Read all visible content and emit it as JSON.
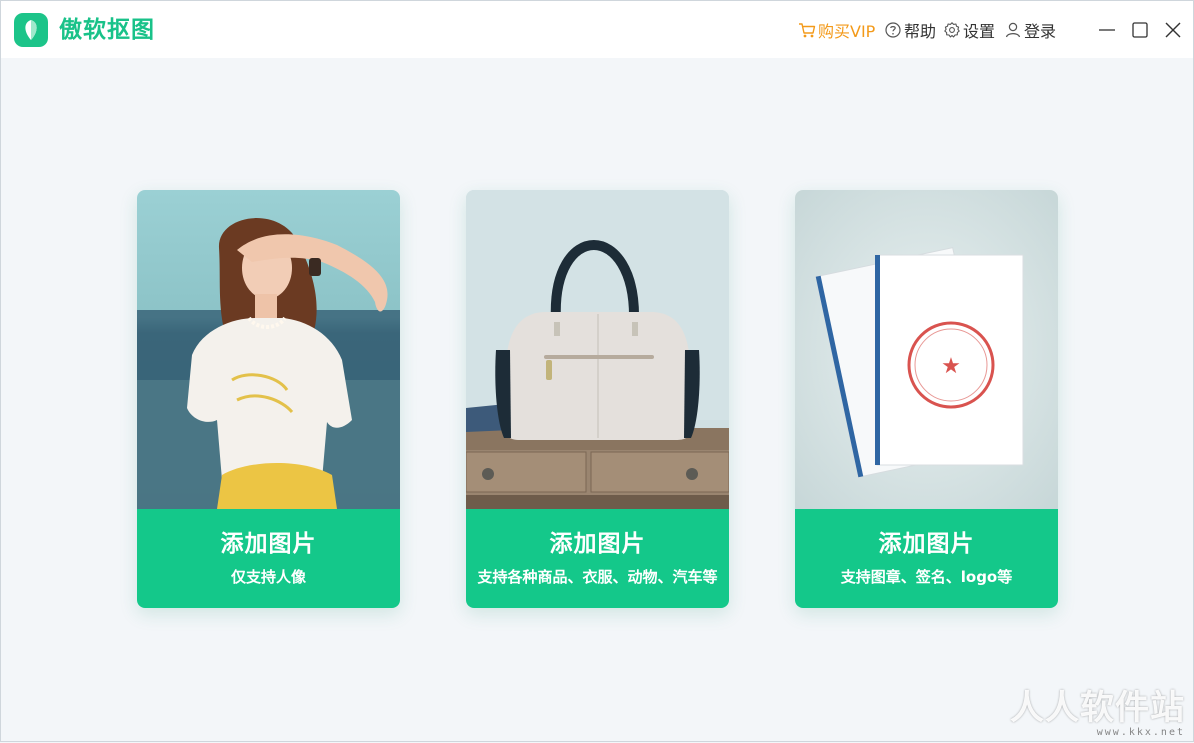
{
  "app": {
    "title": "傲软抠图",
    "brand_color": "#1cc489"
  },
  "top_nav": {
    "vip_label": "购买VIP",
    "help_label": "帮助",
    "settings_label": "设置",
    "login_label": "登录",
    "vip_color": "#f39a1a"
  },
  "window_controls": {
    "minimize_icon": "minimize-icon",
    "maximize_icon": "maximize-icon",
    "close_icon": "close-icon"
  },
  "cards": [
    {
      "title": "添加图片",
      "subtitle": "仅支持人像",
      "image": "portrait-woman-photo"
    },
    {
      "title": "添加图片",
      "subtitle": "支持各种商品、衣服、动物、汽车等",
      "image": "handbag-product-photo"
    },
    {
      "title": "添加图片",
      "subtitle": "支持图章、签名、logo等",
      "image": "stamped-documents-photo",
      "stamp_center_text": "★",
      "stamp_color": "#d9534f"
    }
  ],
  "watermark": {
    "main": "人人软件站",
    "sub": "www.kkx.net"
  }
}
